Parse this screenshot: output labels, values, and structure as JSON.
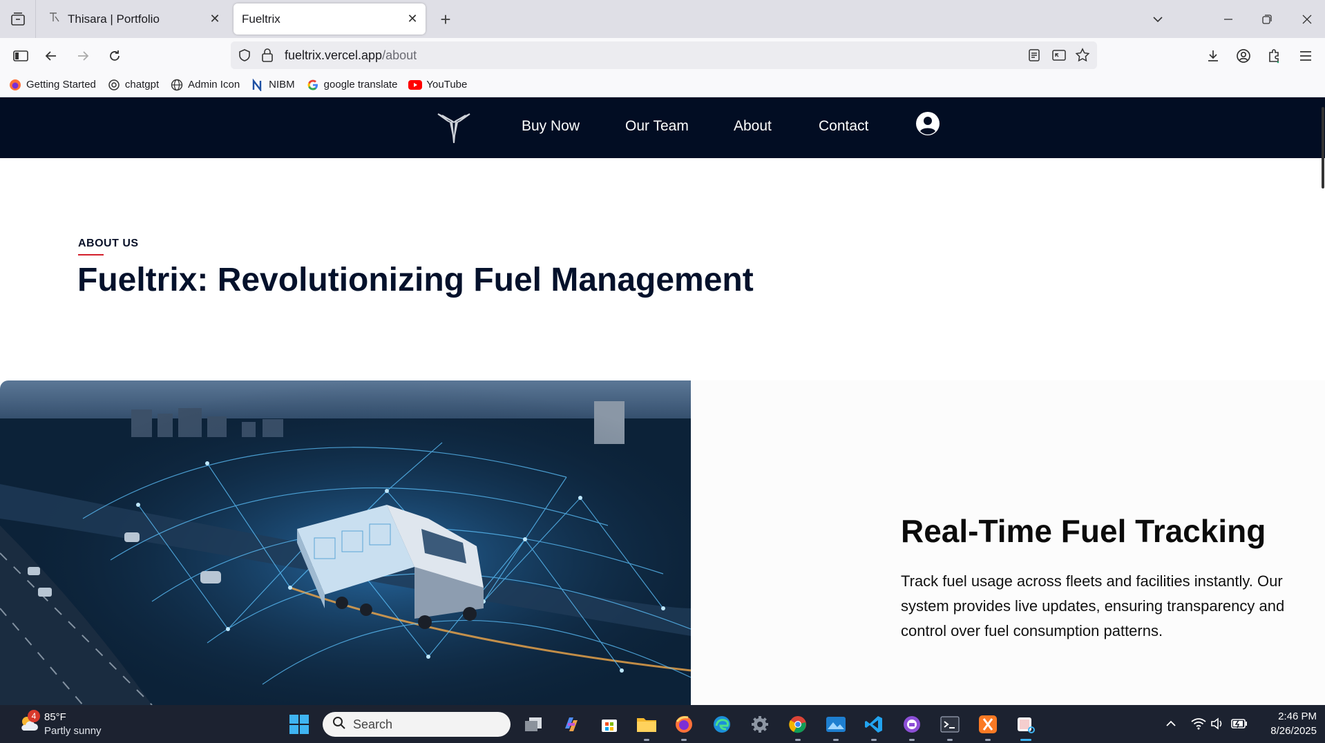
{
  "browser": {
    "tabs": [
      {
        "title": "Thisara | Portfolio",
        "active": false
      },
      {
        "title": "Fueltrix",
        "active": true
      }
    ],
    "url": {
      "domain": "fueltrix.vercel.app",
      "path": "/about"
    },
    "bookmarks": [
      {
        "label": "Getting Started",
        "icon": "firefox-icon"
      },
      {
        "label": "chatgpt",
        "icon": "chatgpt-icon"
      },
      {
        "label": "Admin Icon",
        "icon": "globe-icon"
      },
      {
        "label": "NIBM",
        "icon": "nibm-icon"
      },
      {
        "label": "google translate",
        "icon": "google-icon"
      },
      {
        "label": "YouTube",
        "icon": "youtube-icon"
      }
    ]
  },
  "site": {
    "nav": {
      "links": [
        "Buy Now",
        "Our Team",
        "About",
        "Contact"
      ]
    },
    "about": {
      "eyebrow": "ABOUT US",
      "title": "Fueltrix: Revolutionizing Fuel Management"
    },
    "feature": {
      "heading": "Real-Time Fuel Tracking",
      "text": "Track fuel usage across fleets and facilities instantly. Our system provides live updates, ensuring transparency and control over fuel consumption patterns."
    },
    "colors": {
      "nav_bg": "#020d23",
      "accent": "#d31f2b",
      "title": "#04112b"
    }
  },
  "taskbar": {
    "weather": {
      "badge": "4",
      "temp": "85°F",
      "desc": "Partly sunny"
    },
    "search_placeholder": "Search",
    "clock": {
      "time": "2:46 PM",
      "date": "8/26/2025"
    }
  }
}
